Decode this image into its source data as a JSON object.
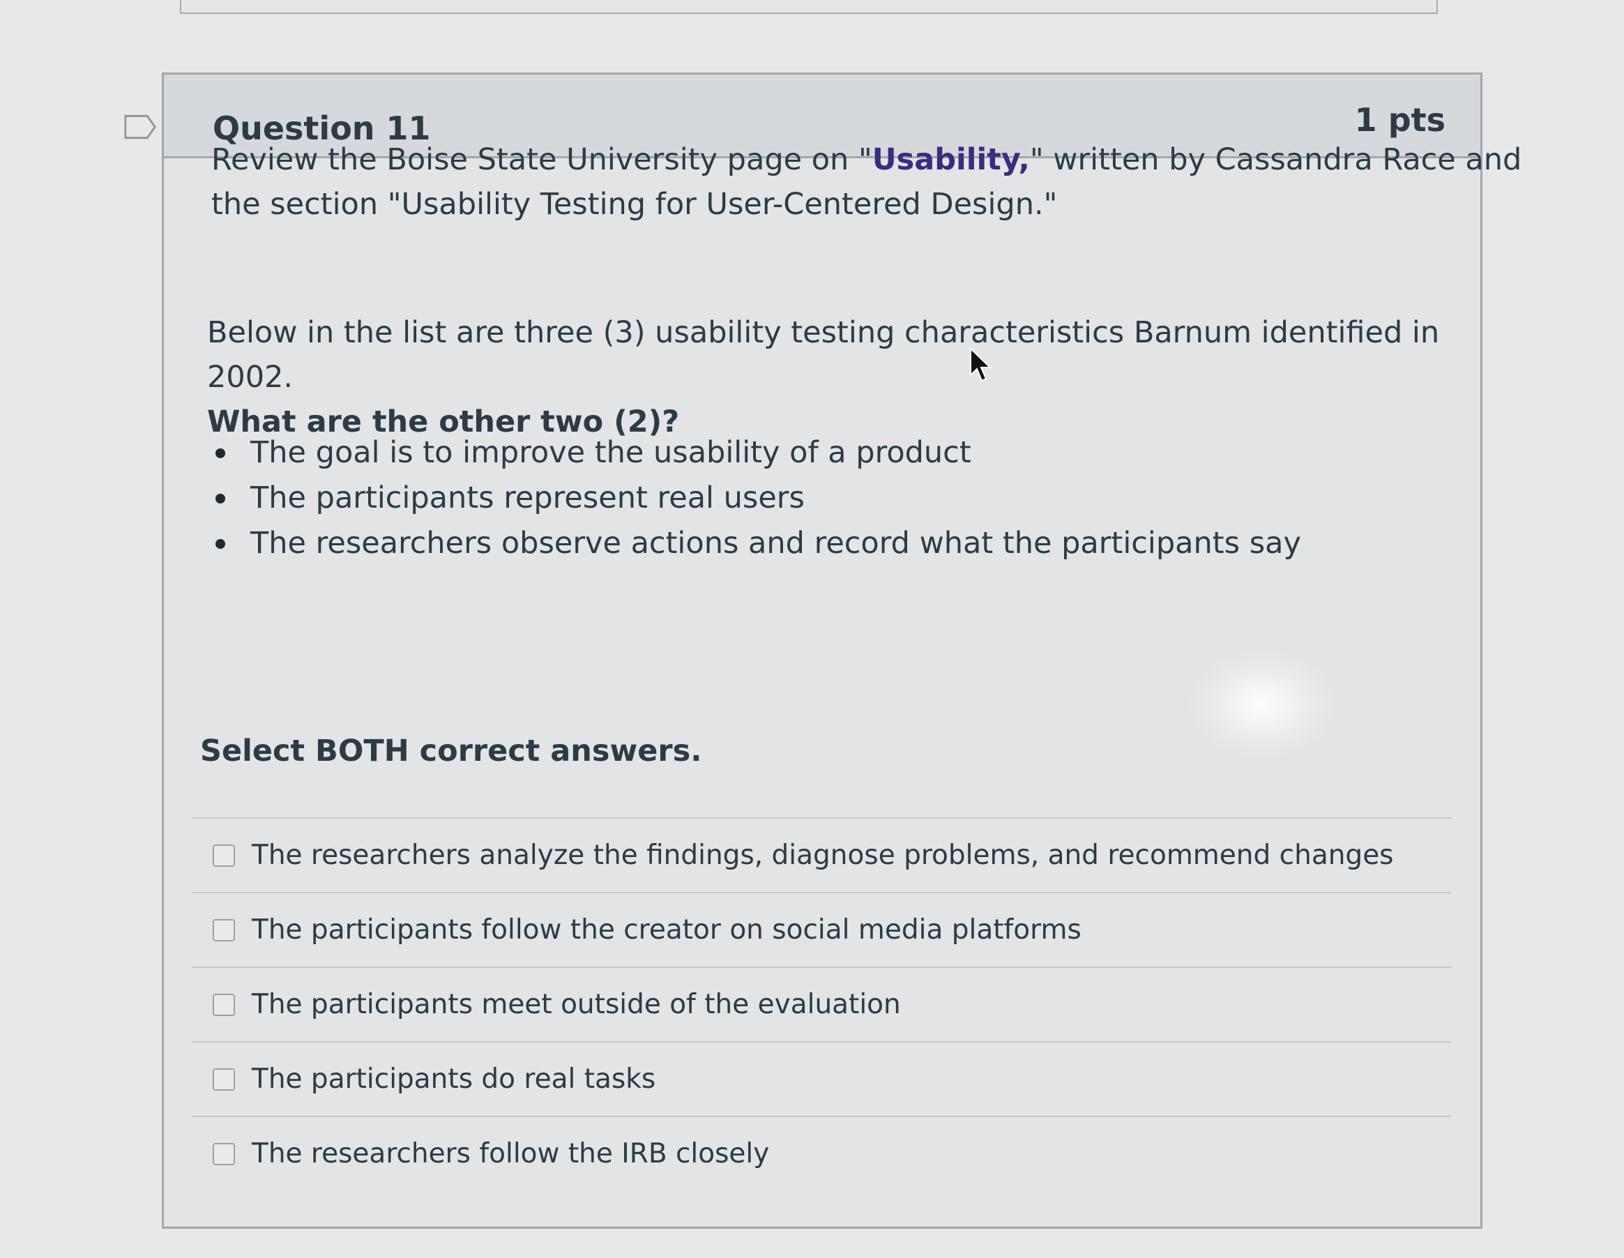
{
  "question": {
    "title": "Question 11",
    "points": "1 pts",
    "intro_before_link": "Review the Boise State University page on \"",
    "intro_link": "Usability,",
    "intro_after_link": "\" written by Cassandra Race and the section \"Usability Testing for User-Centered Design.\"",
    "prompt": "Below in the list are three (3) usability testing characteristics Barnum identified in 2002.",
    "prompt_bold": "What are the other two (2)?",
    "characteristics": [
      "The goal is to improve the usability of a product",
      "The participants represent real users",
      "The researchers observe actions and record what the participants say"
    ],
    "instruction": "Select BOTH correct answers.",
    "answers": [
      {
        "label": "The researchers analyze the findings, diagnose problems, and recommend changes",
        "checked": false
      },
      {
        "label": "The participants follow the creator on social media platforms",
        "checked": false
      },
      {
        "label": "The participants meet outside of the evaluation",
        "checked": false
      },
      {
        "label": "The participants do real tasks",
        "checked": false
      },
      {
        "label": "The researchers follow the IRB closely",
        "checked": false
      }
    ]
  },
  "icons": {
    "flag": "bookmark-flag-icon",
    "cursor": "mouse-pointer-icon"
  },
  "colors": {
    "link": "#3a2c80",
    "text": "#2d3b45",
    "border": "#a3a7ab"
  }
}
